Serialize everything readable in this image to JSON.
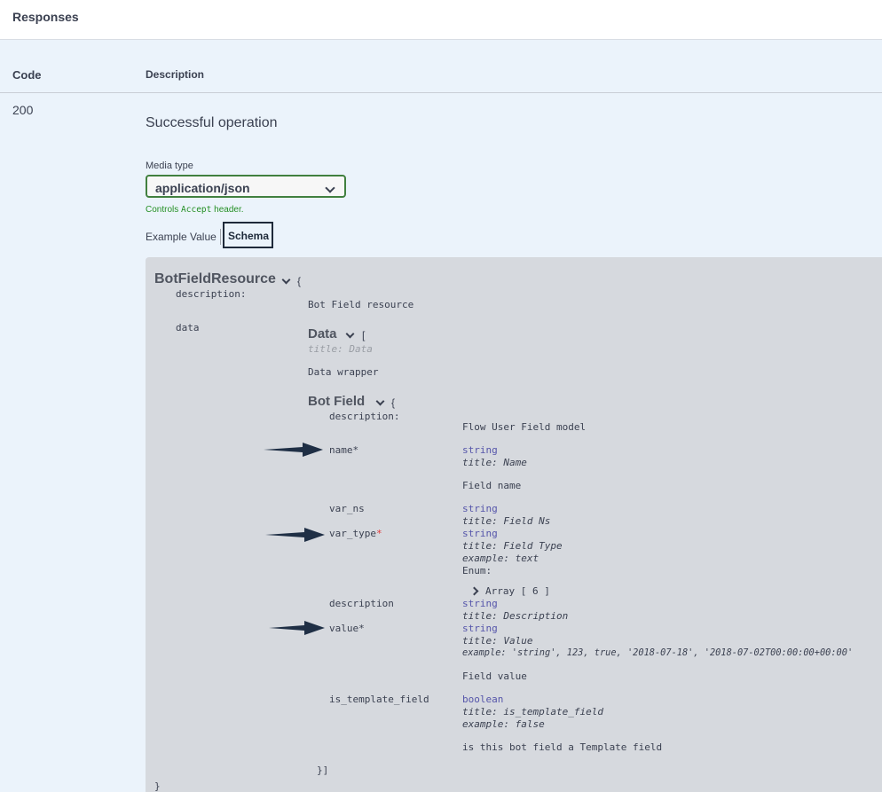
{
  "header": {
    "title": "Responses"
  },
  "table": {
    "code_header": "Code",
    "description_header": "Description"
  },
  "response": {
    "code": "200",
    "description": "Successful operation",
    "media_type_label": "Media type",
    "media_type_value": "application/json",
    "controls_prefix": "Controls",
    "controls_mono": "Accept",
    "controls_suffix": "header.",
    "tabs": {
      "example": "Example Value",
      "schema": "Schema"
    }
  },
  "schema": {
    "root_name": "BotFieldResource",
    "open_brace": "{",
    "close_brace": "}",
    "description_key": "description:",
    "description_value": "Bot Field resource",
    "data_key": "data",
    "data_model": "Data",
    "data_bracket": "[",
    "data_title": "title: Data",
    "data_desc": "Data wrapper",
    "botfield_model": "Bot Field",
    "botfield_brace": "{",
    "bf_desc_key": "description:",
    "bf_desc_value": "Flow User Field model",
    "bf_close": "}]",
    "colors": {
      "type": "#5555aa",
      "required": "#e13b3b",
      "controls": "#248f24",
      "select_border": "#41803f"
    },
    "fields": {
      "name": {
        "key": "name",
        "star": "*",
        "type": "string",
        "title": "title: Name",
        "desc": "Field name"
      },
      "var_ns": {
        "key": "var_ns",
        "type": "string",
        "title": "title: Field Ns"
      },
      "var_type": {
        "key": "var_type",
        "star": "*",
        "type": "string",
        "title": "title: Field Type",
        "example": "example: text",
        "enum": "Enum:",
        "array": "Array [ 6 ]"
      },
      "description": {
        "key": "description",
        "type": "string",
        "title": "title: Description"
      },
      "value": {
        "key": "value",
        "star": "*",
        "type": "string",
        "title": "title: Value",
        "example": "example: 'string', 123, true, '2018-07-18', '2018-07-02T00:00:00+00:00'",
        "desc": "Field value"
      },
      "is_template_field": {
        "key": "is_template_field",
        "type": "boolean",
        "title": "title: is_template_field",
        "example": "example: false",
        "desc": "is this bot field a Template field"
      }
    }
  }
}
